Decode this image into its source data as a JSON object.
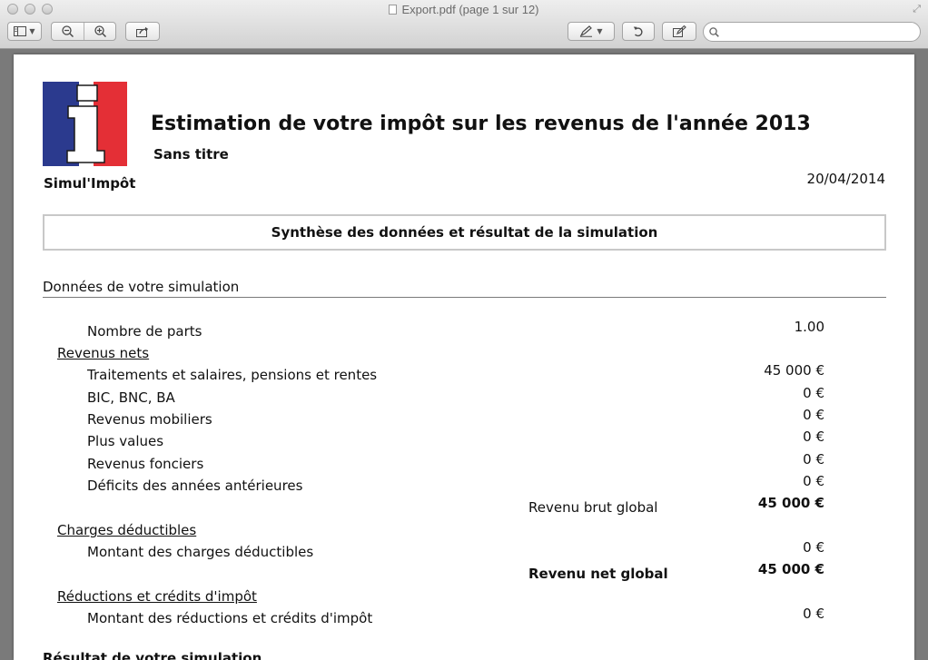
{
  "window": {
    "title": "Export.pdf (page 1 sur 12)"
  },
  "toolbar": {
    "sidebar_icon": "sidebar-icon",
    "zoom_out_icon": "zoom-out-icon",
    "zoom_in_icon": "zoom-in-icon",
    "share_icon": "share-icon",
    "annotate_icon": "pen-icon",
    "rotate_icon": "rotate-icon",
    "edit_icon": "edit-toolbox-icon",
    "search_placeholder": ""
  },
  "document": {
    "title": "Estimation de votre impôt sur les revenus de l'année 2013",
    "subtitle": "Sans titre",
    "brand": "Simul'Impôt",
    "date": "20/04/2014",
    "section_title": "Synthèse des données et résultat de la simulation",
    "data_heading": "Données de votre simulation",
    "logo_colors": [
      "#2b3a8e",
      "#ffffff",
      "#e42f36"
    ],
    "rows": {
      "parts_label": "Nombre de parts",
      "parts_value": "1.00",
      "revenus_nets": "Revenus nets",
      "salaires_label": "Traitements et salaires, pensions et rentes",
      "salaires_value": "45 000 €",
      "bic_label": "BIC, BNC, BA",
      "bic_value": "0 €",
      "mobiliers_label": "Revenus mobiliers",
      "mobiliers_value": "0 €",
      "plus_values_label": "Plus values",
      "plus_values_value": "0 €",
      "fonciers_label": "Revenus fonciers",
      "fonciers_value": "0 €",
      "deficits_label": "Déficits des années antérieures",
      "deficits_value": "0 €",
      "brut_label": "Revenu brut global",
      "brut_value": "45 000 €",
      "charges": "Charges déductibles",
      "charges_label": "Montant des charges déductibles",
      "charges_value": "0 €",
      "net_label": "Revenu net global",
      "net_value": "45 000 €",
      "reductions": "Réductions et crédits d'impôt",
      "reductions_label": "Montant des réductions et crédits d'impôt",
      "reductions_value": "0 €",
      "result_heading_partial": "Résultat de votre simulation"
    }
  }
}
